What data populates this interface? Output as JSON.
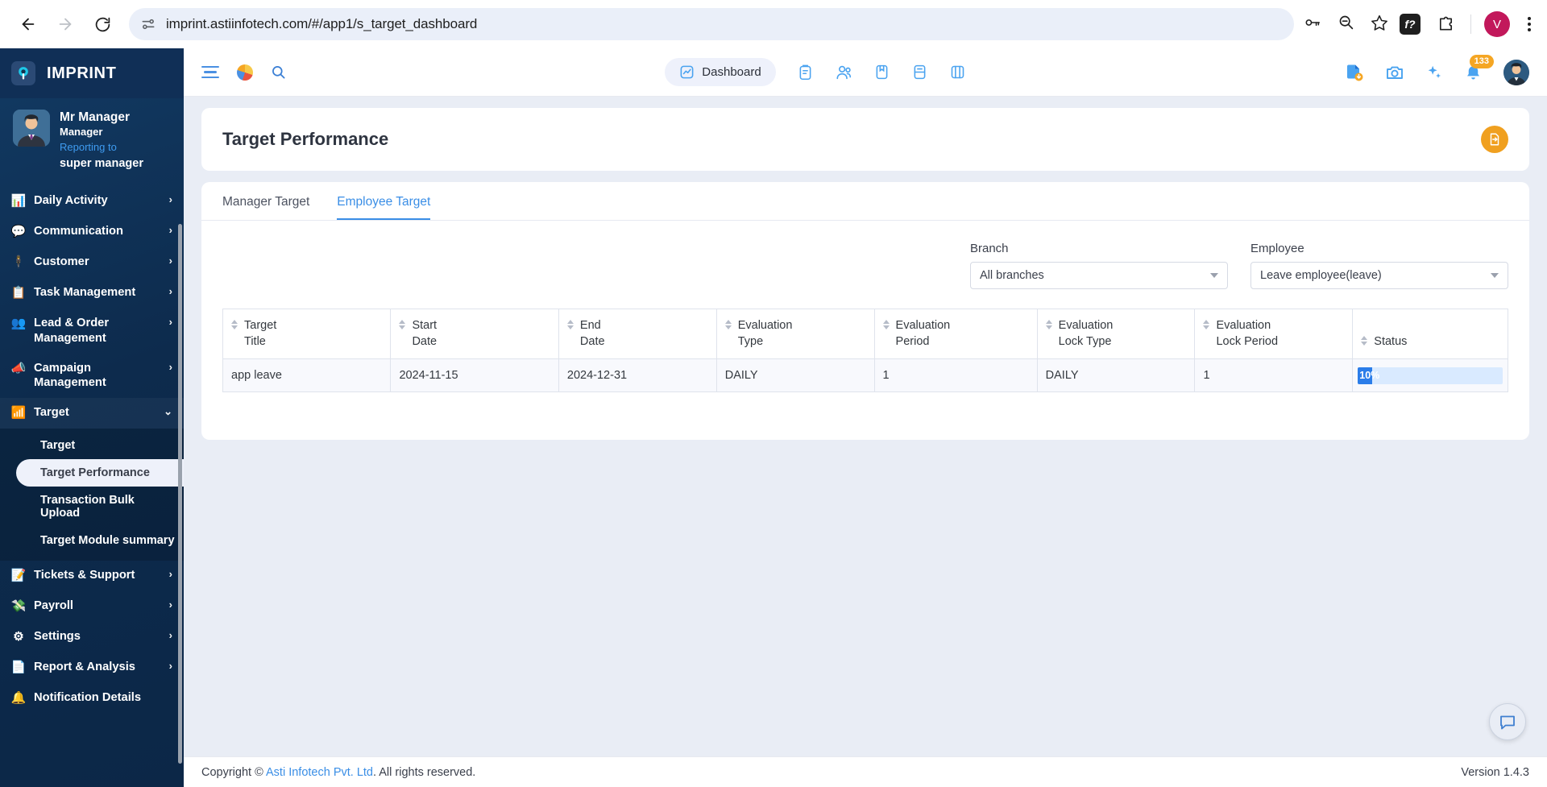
{
  "browser": {
    "url": "imprint.astiinfotech.com/#/app1/s_target_dashboard",
    "back_label": "←",
    "forward_label": "→",
    "reload_label": "⟳",
    "profile_initial": "V",
    "fx_label": "f?"
  },
  "sidebar": {
    "brand": "IMPRINT",
    "user": {
      "name": "Mr Manager",
      "role": "Manager",
      "reporting_label": "Reporting to",
      "reporting_to": "super manager"
    },
    "items": [
      {
        "label": "Daily Activity",
        "icon": "chart-icon",
        "glyph": "📊",
        "chevron": "›"
      },
      {
        "label": "Communication",
        "icon": "chat-icon",
        "glyph": "💬",
        "chevron": "›"
      },
      {
        "label": "Customer",
        "icon": "person-icon",
        "glyph": "🕴",
        "chevron": "›"
      },
      {
        "label": "Task Management",
        "icon": "clipboard-icon",
        "glyph": "📋",
        "chevron": "›"
      },
      {
        "label": "Lead & Order Management",
        "icon": "users-icon",
        "glyph": "👥",
        "chevron": "›"
      },
      {
        "label": "Campaign Management",
        "icon": "megaphone-icon",
        "glyph": "📣",
        "chevron": "›"
      },
      {
        "label": "Target",
        "icon": "bar-chart-icon",
        "glyph": "📶",
        "chevron": "⌄"
      }
    ],
    "target_subitems": [
      {
        "label": "Target",
        "active": false
      },
      {
        "label": "Target Performance",
        "active": true
      },
      {
        "label": "Transaction Bulk Upload",
        "active": false
      },
      {
        "label": "Target Module summary",
        "active": false
      }
    ],
    "items_after": [
      {
        "label": "Tickets & Support",
        "icon": "ticket-icon",
        "glyph": "📝",
        "chevron": "›"
      },
      {
        "label": "Payroll",
        "icon": "payroll-icon",
        "glyph": "💸",
        "chevron": "›"
      },
      {
        "label": "Settings",
        "icon": "gear-icon",
        "glyph": "⚙",
        "chevron": "›"
      },
      {
        "label": "Report & Analysis",
        "icon": "report-icon",
        "glyph": "📄",
        "chevron": "›"
      },
      {
        "label": "Notification Details",
        "icon": "bell-icon",
        "glyph": "🔔",
        "chevron": ""
      }
    ]
  },
  "appbar": {
    "menu_icon": "hamburger-icon",
    "pie_icon": "pie-chart-icon",
    "search_icon": "search-icon",
    "dashboard_label": "Dashboard",
    "nav_icons": [
      "clipboard-icon",
      "team-icon",
      "book-icon",
      "inbox-icon",
      "module-icon"
    ],
    "right_icons": [
      "file-download-icon",
      "camera-icon",
      "sparkle-icon"
    ],
    "notification_count": "133",
    "avatar": "user-avatar"
  },
  "page": {
    "title": "Target Performance",
    "export_icon": "export-file-icon"
  },
  "tabs": [
    {
      "label": "Manager Target",
      "active": false
    },
    {
      "label": "Employee Target",
      "active": true
    }
  ],
  "filters": {
    "branch": {
      "label": "Branch",
      "value": "All branches"
    },
    "employee": {
      "label": "Employee",
      "value": "Leave employee(leave)"
    }
  },
  "table": {
    "columns": [
      {
        "line1": "Target",
        "line2": "Title"
      },
      {
        "line1": "Start",
        "line2": "Date"
      },
      {
        "line1": "End",
        "line2": "Date"
      },
      {
        "line1": "Evaluation",
        "line2": "Type"
      },
      {
        "line1": "Evaluation",
        "line2": "Period"
      },
      {
        "line1": "Evaluation",
        "line2": "Lock Type"
      },
      {
        "line1": "Evaluation",
        "line2": "Lock Period"
      },
      {
        "line1": "Status",
        "line2": ""
      }
    ],
    "rows": [
      {
        "target_title": "app leave",
        "start_date": "2024-11-15",
        "end_date": "2024-12-31",
        "evaluation_type": "DAILY",
        "evaluation_period": "1",
        "evaluation_lock_type": "DAILY",
        "evaluation_lock_period": "1",
        "status_percent": "10%",
        "status_value": 10
      }
    ]
  },
  "footer": {
    "copyright_prefix": "Copyright © ",
    "company": "Asti Infotech Pvt. Ltd",
    "copyright_suffix": ". All rights reserved.",
    "version": "Version 1.4.3"
  },
  "chat": {
    "icon": "chat-bubble-icon"
  },
  "colors": {
    "sidebar_top": "#123a63",
    "sidebar_bottom": "#0c2747",
    "accent_blue": "#3a8ee6",
    "progress_fill": "#2b7de9",
    "progress_track": "#d9eaff",
    "fab_orange": "#f0a020",
    "badge_orange": "#f5a623"
  }
}
